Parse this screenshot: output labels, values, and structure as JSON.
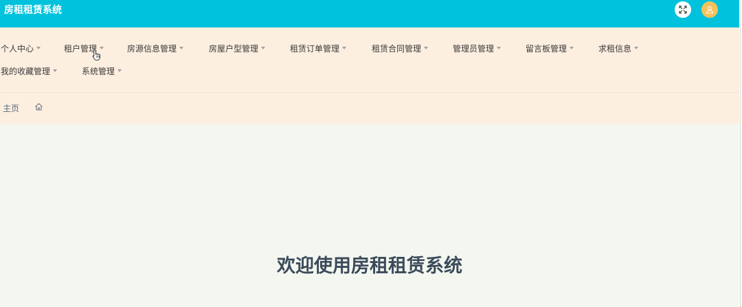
{
  "app": {
    "title": "房租租赁系统"
  },
  "header": {
    "fullscreen_icon": "fullscreen-icon",
    "avatar_icon": "user-icon"
  },
  "nav": {
    "items": [
      {
        "label": "个人中心"
      },
      {
        "label": "租户管理"
      },
      {
        "label": "房源信息管理"
      },
      {
        "label": "房屋户型管理"
      },
      {
        "label": "租赁订单管理"
      },
      {
        "label": "租赁合同管理"
      },
      {
        "label": "管理员管理"
      },
      {
        "label": "留言板管理"
      },
      {
        "label": "求租信息"
      },
      {
        "label": "我的收藏管理"
      },
      {
        "label": "系统管理"
      }
    ]
  },
  "breadcrumb": {
    "home_label": "主页",
    "home_icon": "home-icon"
  },
  "main": {
    "welcome_text": "欢迎使用房租租赁系统"
  },
  "colors": {
    "header_bg": "#00c2dc",
    "nav_bg": "#fdefe0",
    "content_bg": "#f4f7f0",
    "avatar_bg": "#f6c25c",
    "welcome_text": "#3b4a5a"
  }
}
